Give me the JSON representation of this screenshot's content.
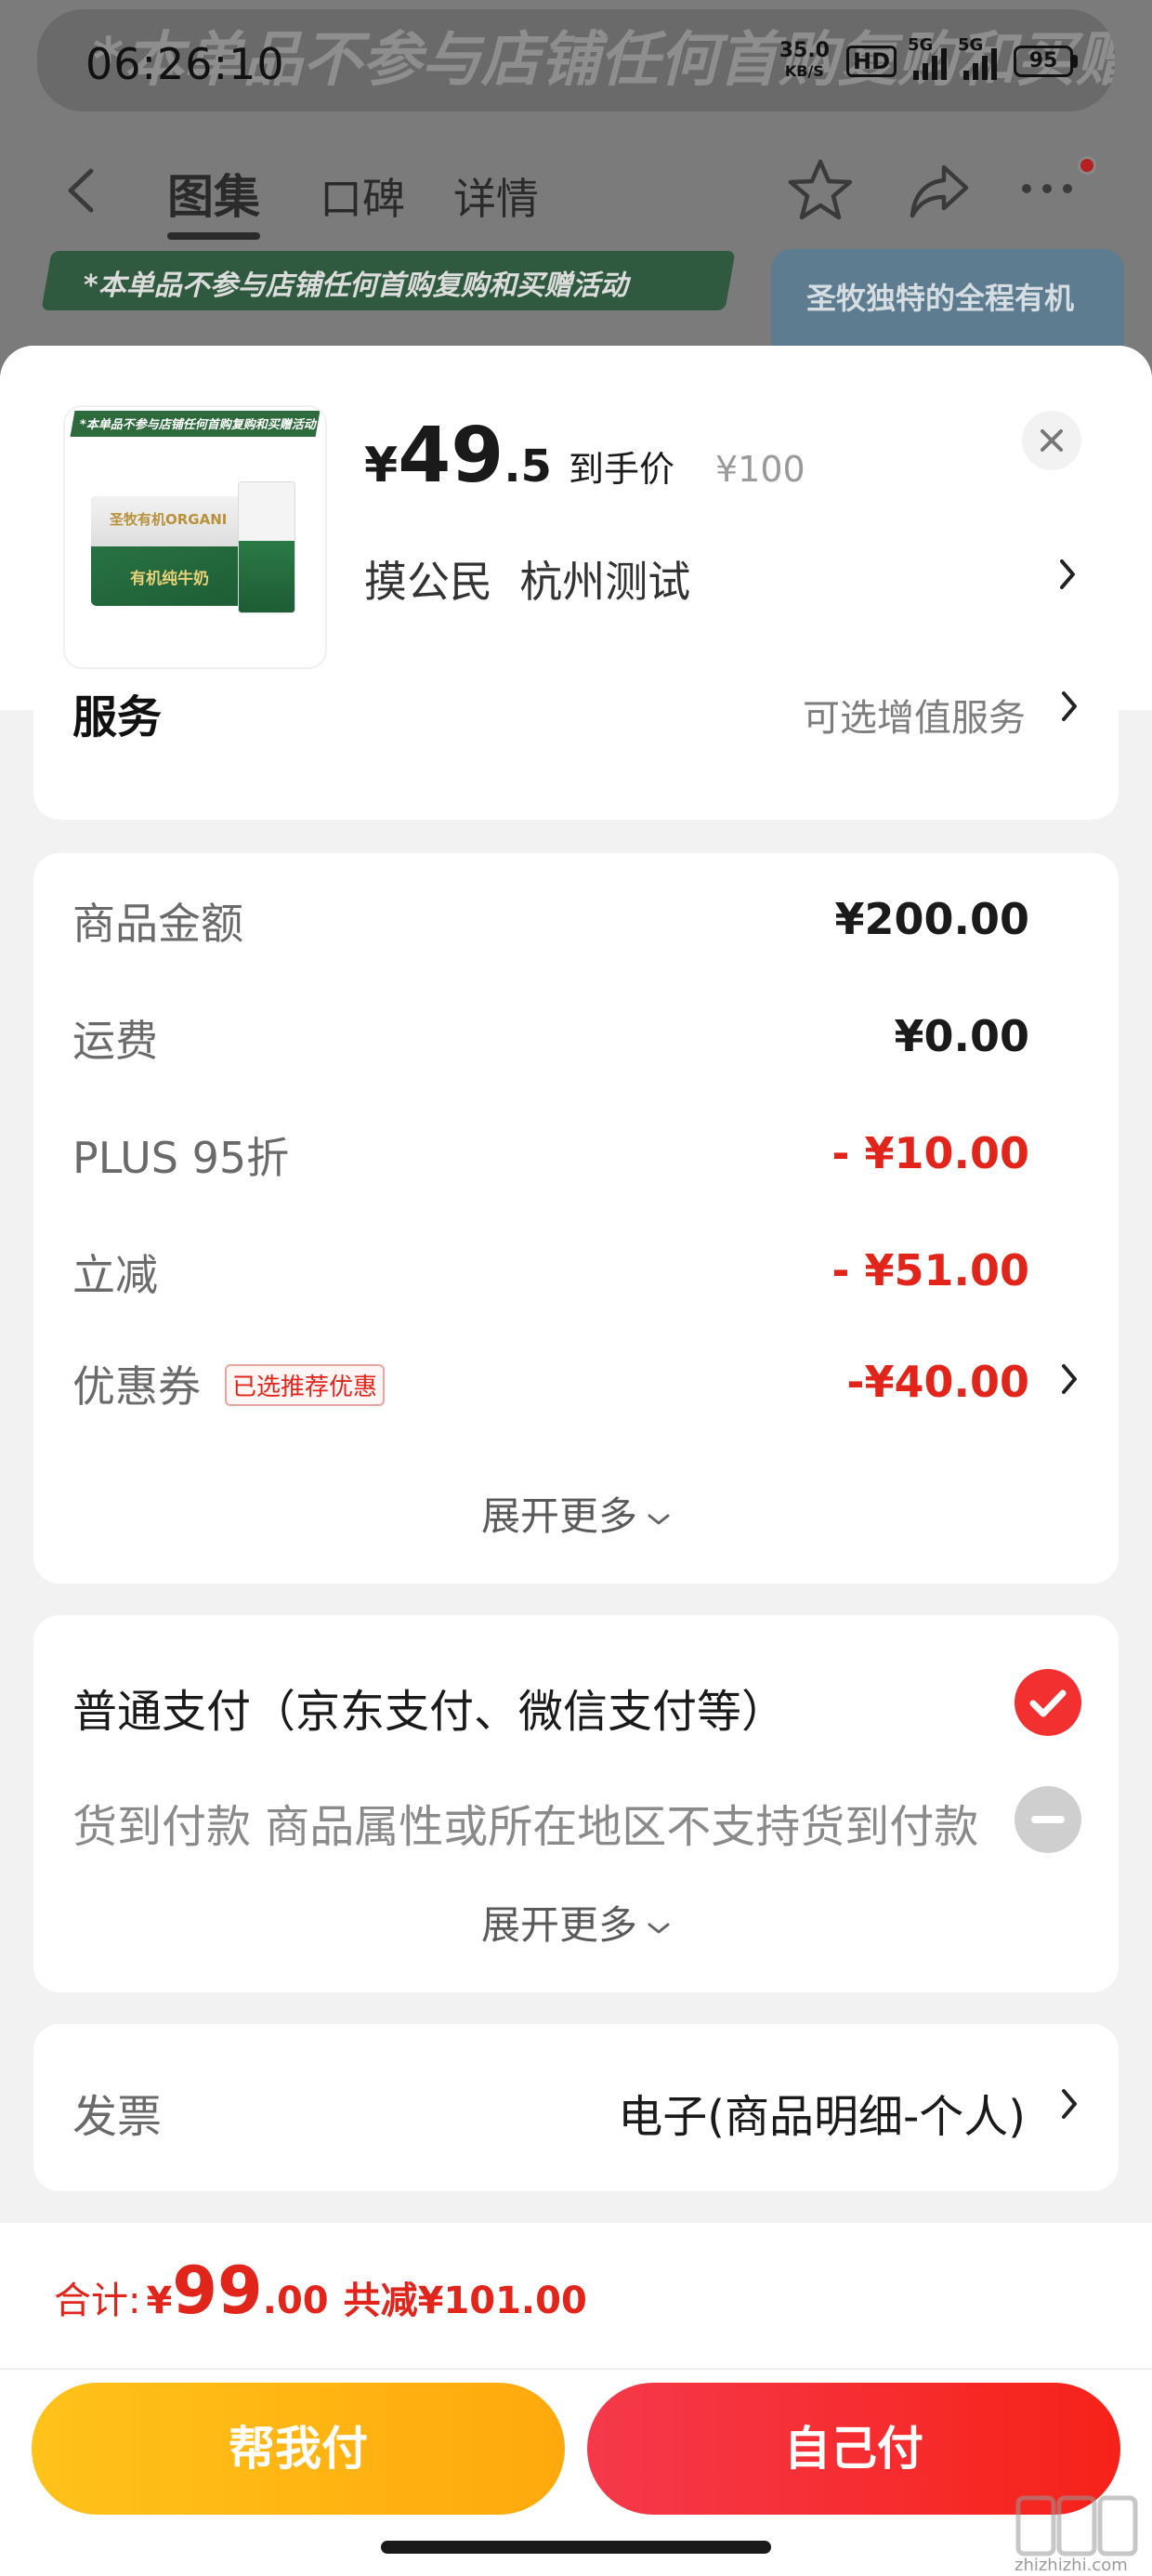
{
  "background": {
    "banner_ghost_text": "*本单品不参与店铺任何首购复购和买赠活动",
    "status_bar": {
      "time": "06:26:10",
      "net_speed": "35.0",
      "net_unit": "KB/S",
      "hd": "HD",
      "signal1": "5G",
      "signal2": "5G",
      "battery": "95"
    },
    "nav": {
      "tabs": [
        "图集",
        "口碑",
        "详情"
      ]
    },
    "promo_text": "*本单品不参与店铺任何首购复购和买赠活动",
    "side_card_text": "圣牧独特的全程有机"
  },
  "product": {
    "thumb_banner": "*本单品不参与店铺任何首购复购和买赠活动",
    "box_brand": "圣牧有机ORGANI",
    "box_label": "有机纯牛奶",
    "price_yen": "¥",
    "price_int": "49",
    "price_dec": ".5",
    "price_tag": "到手价",
    "original_price": "¥100",
    "address": "摸公民  杭州测试"
  },
  "service": {
    "title": "服务",
    "value": "可选增值服务"
  },
  "amounts": {
    "rows": [
      {
        "label": "商品金额",
        "value": "¥200.00"
      },
      {
        "label": "运费",
        "value": "¥0.00"
      },
      {
        "label": "PLUS 95折",
        "value": "- ¥10.00"
      },
      {
        "label": "立减",
        "value": "- ¥51.00"
      },
      {
        "label": "优惠券",
        "value": "-¥40.00"
      }
    ],
    "coupon_badge": "已选推荐优惠",
    "expand": "展开更多"
  },
  "payment": {
    "main": "普通支付（京东支付、微信支付等）",
    "cod": "货到付款 商品属性或所在地区不支持货到付款",
    "expand": "展开更多"
  },
  "invoice": {
    "label": "发票",
    "value": "电子(商品明细-个人)"
  },
  "bottom": {
    "total_label": "合计:",
    "total_yen": "¥",
    "total_int": "99",
    "total_dec": ".00",
    "total_save": "共减¥101.00",
    "btn_help": "帮我付",
    "btn_self": "自己付",
    "watermark": "zhizhizhi.com"
  },
  "colors": {
    "accent_red": "#e1251b",
    "pay_button": "#f62218",
    "help_button": "#ffa90c"
  }
}
